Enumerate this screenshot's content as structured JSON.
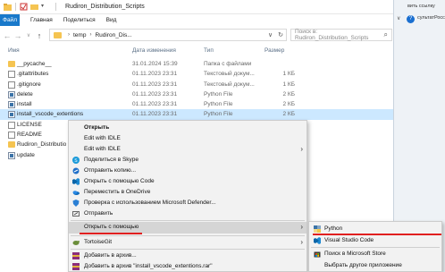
{
  "window": {
    "title": "Rudiron_Distribution_Scripts",
    "ribbon_tabs": [
      "Файл",
      "Главная",
      "Поделиться",
      "Вид"
    ],
    "address": {
      "parts": [
        "temp",
        "Rudiron_Dis..."
      ]
    },
    "search_placeholder": "Поиск в: Rudiron_Distribution_Scripts"
  },
  "columns": {
    "name": "Имя",
    "date": "Дата изменения",
    "type": "Тип",
    "size": "Размер"
  },
  "files": [
    {
      "name": "__pycache__",
      "date": "31.01.2024 15:39",
      "type": "Папка с файлами",
      "size": "",
      "icon": "folder"
    },
    {
      "name": ".gitattributes",
      "date": "01.11.2023 23:31",
      "type": "Текстовый докум...",
      "size": "1 КБ",
      "icon": "doc"
    },
    {
      "name": ".gitignore",
      "date": "01.11.2023 23:31",
      "type": "Текстовый докум...",
      "size": "1 КБ",
      "icon": "doc"
    },
    {
      "name": "delete",
      "date": "01.11.2023 23:31",
      "type": "Python File",
      "size": "2 КБ",
      "icon": "py"
    },
    {
      "name": "install",
      "date": "01.11.2023 23:31",
      "type": "Python File",
      "size": "2 КБ",
      "icon": "py"
    },
    {
      "name": "install_vscode_extentions",
      "date": "01.11.2023 23:31",
      "type": "Python File",
      "size": "2 КБ",
      "icon": "py"
    },
    {
      "name": "LICENSE",
      "date": "",
      "type": "",
      "size": "",
      "icon": "doc"
    },
    {
      "name": "README",
      "date": "",
      "type": "",
      "size": "",
      "icon": "doc"
    },
    {
      "name": "Rudiron_Distributio",
      "date": "",
      "type": "",
      "size": "",
      "icon": "folder"
    },
    {
      "name": "update",
      "date": "",
      "type": "",
      "size": "",
      "icon": "py"
    }
  ],
  "context_menu": {
    "open": "Открыть",
    "edit_idle": "Edit with IDLE",
    "edit_idle2": "Edit with IDLE",
    "skype": "Поделиться в Skype",
    "send_copy": "Отправить копию...",
    "open_vscode": "Открыть с помощью Code",
    "onedrive": "Переместить в OneDrive",
    "defender": "Проверка с использованием Microsoft Defender...",
    "send": "Отправить",
    "open_with": "Открыть с помощью",
    "tortoise": "TortoiseGit",
    "add_archive": "Добавить в архив...",
    "add_rar": "Добавить в архив \"install_vscode_extentions.rar\""
  },
  "submenu": {
    "python": "Python",
    "vscode": "Visual Studio Code",
    "store": "Поиск в Microsoft Store",
    "other": "Выбрать другое приложение"
  },
  "right_strip": {
    "line1": "вить ссылку",
    "line2": "сультатРосс"
  },
  "colors": {
    "accent": "#1979ca",
    "selection": "#cce8ff",
    "red_underline": "#e02020"
  }
}
